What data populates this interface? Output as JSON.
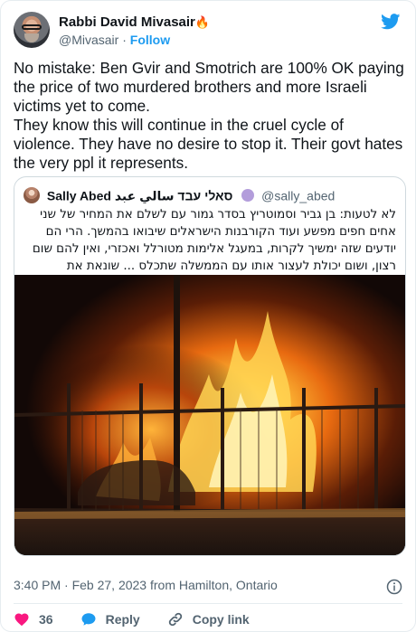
{
  "author": {
    "display_name": "Rabbi David Mivasair",
    "name_emoji": "🔥",
    "handle": "@Mivasair",
    "separator": "·",
    "follow_label": "Follow"
  },
  "tweet": {
    "text": "No mistake:  Ben Gvir and Smotrich are 100% OK paying the price of two murdered brothers and more Israeli victims yet to come.\nThey know this will continue in the cruel cycle of violence.  They have no desire to stop it.  Their govt hates the very ppl it represents."
  },
  "quoted": {
    "display_name": "Sally Abed סאלי עבד سالي عبد",
    "handle": "@sally_abed",
    "text": "לא לטעות: בן גביר וסמוטריץ בסדר גמור עם לשלם את המחיר של שני אחים חפים מפשע ועוד הקורבנות הישראלים שיבואו בהמשך. הרי הם יודעים שזה ימשיך לקרות, במעגל אלימות מטורלל ואכזרי, ואין להם שום רצון, ושום יכולת לעצור אותו עם הממשלה שתכלס ... שונאת את האנשים שהיא מייצגת.",
    "image_alt": "burning cars behind a metal fence at night"
  },
  "meta": {
    "timestamp": "3:40 PM · Feb 27, 2023 from Hamilton, Ontario"
  },
  "actions": {
    "like_count": "36",
    "reply_label": "Reply",
    "copy_link_label": "Copy link"
  },
  "colors": {
    "twitter_blue": "#1d9bf0",
    "like_red": "#f91880",
    "text_secondary": "#536471"
  },
  "icons": [
    "twitter-bird-icon",
    "verified-badge-icon",
    "info-icon",
    "heart-icon",
    "reply-bubble-icon",
    "link-icon"
  ]
}
